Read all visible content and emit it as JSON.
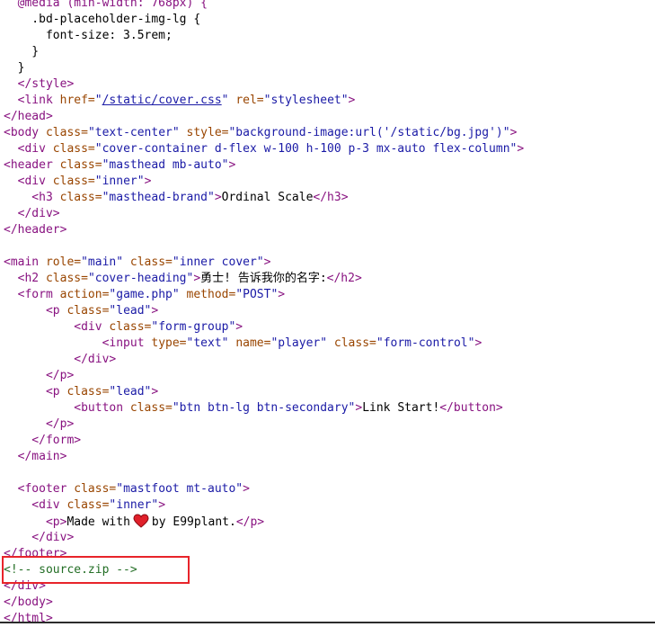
{
  "source_lines": [
    [
      {
        "t": "tag",
        "s": "  @media (min-width: 768px) {"
      }
    ],
    [
      {
        "t": "txt",
        "s": "    .bd-placeholder-img-lg {"
      }
    ],
    [
      {
        "t": "txt",
        "s": "      font-size: 3.5rem;"
      }
    ],
    [
      {
        "t": "txt",
        "s": "    }"
      }
    ],
    [
      {
        "t": "txt",
        "s": "  }"
      }
    ],
    [
      {
        "t": "tag",
        "s": "  </style>"
      }
    ],
    [
      {
        "t": "tag",
        "s": "  <link "
      },
      {
        "t": "attr",
        "s": "href="
      },
      {
        "t": "val",
        "s": "\""
      },
      {
        "t": "link",
        "s": "/static/cover.css"
      },
      {
        "t": "val",
        "s": "\""
      },
      {
        "t": "txt",
        "s": " "
      },
      {
        "t": "attr",
        "s": "rel="
      },
      {
        "t": "val",
        "s": "\"stylesheet\""
      },
      {
        "t": "tag",
        "s": ">"
      }
    ],
    [
      {
        "t": "tag",
        "s": "</head>"
      }
    ],
    [
      {
        "t": "tag",
        "s": "<body "
      },
      {
        "t": "attr",
        "s": "class="
      },
      {
        "t": "val",
        "s": "\"text-center\""
      },
      {
        "t": "txt",
        "s": " "
      },
      {
        "t": "attr",
        "s": "style="
      },
      {
        "t": "val",
        "s": "\"background-image:url('/static/bg.jpg')\""
      },
      {
        "t": "tag",
        "s": ">"
      }
    ],
    [
      {
        "t": "tag",
        "s": "  <div "
      },
      {
        "t": "attr",
        "s": "class="
      },
      {
        "t": "val",
        "s": "\"cover-container d-flex w-100 h-100 p-3 mx-auto flex-column\""
      },
      {
        "t": "tag",
        "s": ">"
      }
    ],
    [
      {
        "t": "tag",
        "s": "<header "
      },
      {
        "t": "attr",
        "s": "class="
      },
      {
        "t": "val",
        "s": "\"masthead mb-auto\""
      },
      {
        "t": "tag",
        "s": ">"
      }
    ],
    [
      {
        "t": "tag",
        "s": "  <div "
      },
      {
        "t": "attr",
        "s": "class="
      },
      {
        "t": "val",
        "s": "\"inner\""
      },
      {
        "t": "tag",
        "s": ">"
      }
    ],
    [
      {
        "t": "tag",
        "s": "    <h3 "
      },
      {
        "t": "attr",
        "s": "class="
      },
      {
        "t": "val",
        "s": "\"masthead-brand\""
      },
      {
        "t": "tag",
        "s": ">"
      },
      {
        "t": "txt",
        "s": "Ordinal Scale"
      },
      {
        "t": "tag",
        "s": "</h3>"
      }
    ],
    [
      {
        "t": "tag",
        "s": "  </div>"
      }
    ],
    [
      {
        "t": "tag",
        "s": "</header>"
      }
    ],
    [],
    [
      {
        "t": "tag",
        "s": "<main "
      },
      {
        "t": "attr",
        "s": "role="
      },
      {
        "t": "val",
        "s": "\"main\""
      },
      {
        "t": "txt",
        "s": " "
      },
      {
        "t": "attr",
        "s": "class="
      },
      {
        "t": "val",
        "s": "\"inner cover\""
      },
      {
        "t": "tag",
        "s": ">"
      }
    ],
    [
      {
        "t": "tag",
        "s": "  <h2 "
      },
      {
        "t": "attr",
        "s": "class="
      },
      {
        "t": "val",
        "s": "\"cover-heading\""
      },
      {
        "t": "tag",
        "s": ">"
      },
      {
        "t": "txt",
        "s": "勇士! 告诉我你的名字:"
      },
      {
        "t": "tag",
        "s": "</h2>"
      }
    ],
    [
      {
        "t": "tag",
        "s": "  <form "
      },
      {
        "t": "attr",
        "s": "action="
      },
      {
        "t": "val",
        "s": "\"game.php\""
      },
      {
        "t": "txt",
        "s": " "
      },
      {
        "t": "attr",
        "s": "method="
      },
      {
        "t": "val",
        "s": "\"POST\""
      },
      {
        "t": "tag",
        "s": ">"
      }
    ],
    [
      {
        "t": "tag",
        "s": "      <p "
      },
      {
        "t": "attr",
        "s": "class="
      },
      {
        "t": "val",
        "s": "\"lead\""
      },
      {
        "t": "tag",
        "s": ">"
      }
    ],
    [
      {
        "t": "tag",
        "s": "          <div "
      },
      {
        "t": "attr",
        "s": "class="
      },
      {
        "t": "val",
        "s": "\"form-group\""
      },
      {
        "t": "tag",
        "s": ">"
      }
    ],
    [
      {
        "t": "tag",
        "s": "              <input "
      },
      {
        "t": "attr",
        "s": "type="
      },
      {
        "t": "val",
        "s": "\"text\""
      },
      {
        "t": "txt",
        "s": " "
      },
      {
        "t": "attr",
        "s": "name="
      },
      {
        "t": "val",
        "s": "\"player\""
      },
      {
        "t": "txt",
        "s": " "
      },
      {
        "t": "attr",
        "s": "class="
      },
      {
        "t": "val",
        "s": "\"form-control\""
      },
      {
        "t": "tag",
        "s": ">"
      }
    ],
    [
      {
        "t": "tag",
        "s": "          </div>"
      }
    ],
    [
      {
        "t": "tag",
        "s": "      </p>"
      }
    ],
    [
      {
        "t": "tag",
        "s": "      <p "
      },
      {
        "t": "attr",
        "s": "class="
      },
      {
        "t": "val",
        "s": "\"lead\""
      },
      {
        "t": "tag",
        "s": ">"
      }
    ],
    [
      {
        "t": "tag",
        "s": "          <button "
      },
      {
        "t": "attr",
        "s": "class="
      },
      {
        "t": "val",
        "s": "\"btn btn-lg btn-secondary\""
      },
      {
        "t": "tag",
        "s": ">"
      },
      {
        "t": "txt",
        "s": "Link Start!"
      },
      {
        "t": "tag",
        "s": "</button>"
      }
    ],
    [
      {
        "t": "tag",
        "s": "      </p>"
      }
    ],
    [
      {
        "t": "tag",
        "s": "    </form>"
      }
    ],
    [
      {
        "t": "tag",
        "s": "  </main>"
      }
    ],
    [],
    [
      {
        "t": "tag",
        "s": "  <footer "
      },
      {
        "t": "attr",
        "s": "class="
      },
      {
        "t": "val",
        "s": "\"mastfoot mt-auto\""
      },
      {
        "t": "tag",
        "s": ">"
      }
    ],
    [
      {
        "t": "tag",
        "s": "    <div "
      },
      {
        "t": "attr",
        "s": "class="
      },
      {
        "t": "val",
        "s": "\"inner\""
      },
      {
        "t": "tag",
        "s": ">"
      }
    ],
    [
      {
        "t": "tag",
        "s": "      <p>"
      },
      {
        "t": "txt",
        "s": "Made with"
      },
      {
        "t": "heart",
        "s": ""
      },
      {
        "t": "txt",
        "s": "by E99plant."
      },
      {
        "t": "tag",
        "s": "</p>"
      }
    ],
    [
      {
        "t": "tag",
        "s": "    </div>"
      }
    ],
    [
      {
        "t": "tag",
        "s": "</footer>"
      }
    ],
    [
      {
        "t": "cmt",
        "s": "<!-- source.zip -->"
      }
    ],
    [
      {
        "t": "tag",
        "s": "</div>"
      }
    ],
    [
      {
        "t": "tag",
        "s": "</body>"
      }
    ],
    [
      {
        "t": "tag",
        "s": "</html>"
      }
    ]
  ],
  "highlighted_comment": "<!-- source.zip -->",
  "colors": {
    "tag": "#881280",
    "attribute": "#994500",
    "value": "#1a1aa6",
    "comment": "#236e25",
    "highlight_border": "#e8242a",
    "heart": "#e0202a"
  },
  "icons": {
    "heart": "heart-emoji-icon"
  }
}
